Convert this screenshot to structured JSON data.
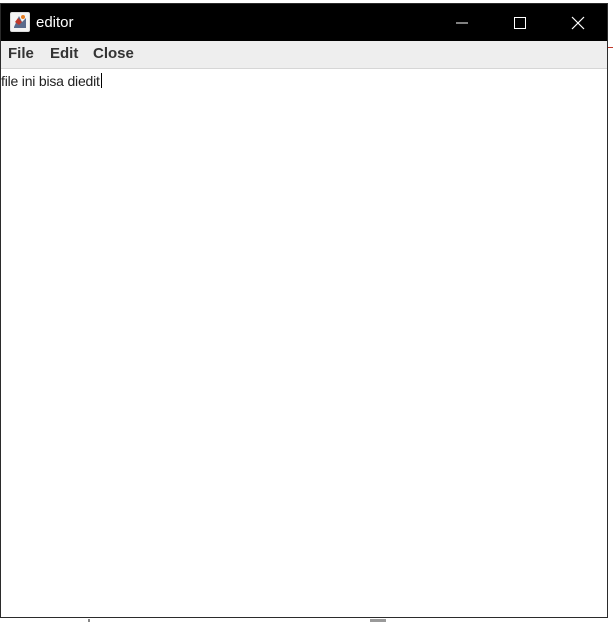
{
  "window": {
    "title": "editor",
    "app_icon": "java-app-icon",
    "controls": {
      "minimize_icon": "minimize-icon",
      "maximize_icon": "maximize-icon",
      "close_icon": "close-icon"
    }
  },
  "menubar": {
    "items": [
      {
        "label": "File"
      },
      {
        "label": "Edit"
      },
      {
        "label": "Close"
      }
    ]
  },
  "editor": {
    "content": "file ini bisa diedit"
  },
  "colors": {
    "titlebar": "#000000",
    "menubar": "#eeeeee",
    "editor_bg": "#ffffff"
  }
}
